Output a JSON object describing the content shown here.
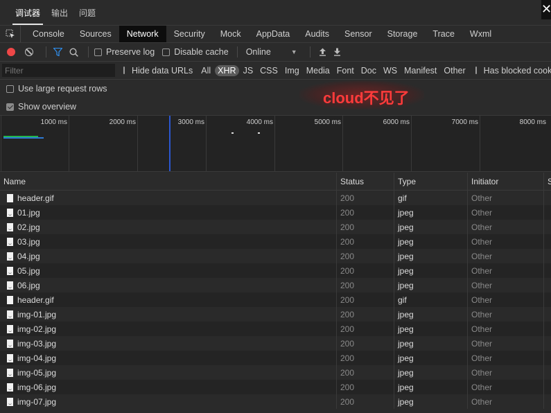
{
  "top_tabs": [
    "调试器",
    "输出",
    "问题"
  ],
  "close_label": "✕",
  "panel_tabs": [
    "Console",
    "Sources",
    "Network",
    "Security",
    "Mock",
    "AppData",
    "Audits",
    "Sensor",
    "Storage",
    "Trace",
    "Wxml"
  ],
  "active_panel": "Network",
  "toolbar": {
    "preserve_log": "Preserve log",
    "disable_cache": "Disable cache",
    "throttle": "Online"
  },
  "filter": {
    "placeholder": "Filter",
    "hide_data_urls": "Hide data URLs",
    "types": [
      "All",
      "XHR",
      "JS",
      "CSS",
      "Img",
      "Media",
      "Font",
      "Doc",
      "WS",
      "Manifest",
      "Other"
    ],
    "active_type": "XHR",
    "blocked_cookies": "Has blocked cookies"
  },
  "options": {
    "large_rows": "Use large request rows",
    "show_overview": "Show overview"
  },
  "annotation": "cloud不见了",
  "overview": {
    "ticks": [
      "1000 ms",
      "2000 ms",
      "3000 ms",
      "4000 ms",
      "5000 ms",
      "6000 ms",
      "7000 ms",
      "8000 ms"
    ]
  },
  "grid": {
    "headers": [
      "Name",
      "Status",
      "Type",
      "Initiator",
      "S"
    ],
    "rows": [
      {
        "name": "header.gif",
        "status": "200",
        "type": "gif",
        "initiator": "Other"
      },
      {
        "name": "01.jpg",
        "status": "200",
        "type": "jpeg",
        "initiator": "Other"
      },
      {
        "name": "02.jpg",
        "status": "200",
        "type": "jpeg",
        "initiator": "Other"
      },
      {
        "name": "03.jpg",
        "status": "200",
        "type": "jpeg",
        "initiator": "Other"
      },
      {
        "name": "04.jpg",
        "status": "200",
        "type": "jpeg",
        "initiator": "Other"
      },
      {
        "name": "05.jpg",
        "status": "200",
        "type": "jpeg",
        "initiator": "Other"
      },
      {
        "name": "06.jpg",
        "status": "200",
        "type": "jpeg",
        "initiator": "Other"
      },
      {
        "name": "header.gif",
        "status": "200",
        "type": "gif",
        "initiator": "Other"
      },
      {
        "name": "img-01.jpg",
        "status": "200",
        "type": "jpeg",
        "initiator": "Other"
      },
      {
        "name": "img-02.jpg",
        "status": "200",
        "type": "jpeg",
        "initiator": "Other"
      },
      {
        "name": "img-03.jpg",
        "status": "200",
        "type": "jpeg",
        "initiator": "Other"
      },
      {
        "name": "img-04.jpg",
        "status": "200",
        "type": "jpeg",
        "initiator": "Other"
      },
      {
        "name": "img-05.jpg",
        "status": "200",
        "type": "jpeg",
        "initiator": "Other"
      },
      {
        "name": "img-06.jpg",
        "status": "200",
        "type": "jpeg",
        "initiator": "Other"
      },
      {
        "name": "img-07.jpg",
        "status": "200",
        "type": "jpeg",
        "initiator": "Other"
      }
    ]
  }
}
